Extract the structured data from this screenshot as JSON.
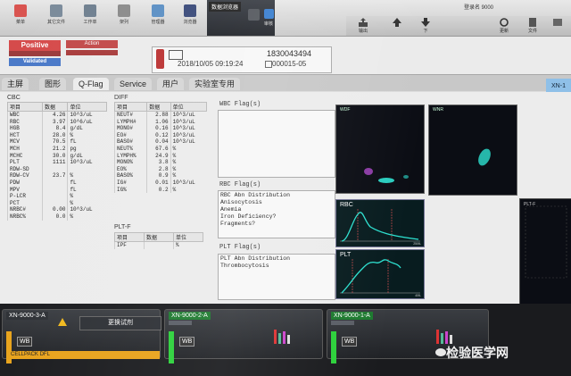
{
  "toolbar": {
    "left_buttons": [
      "菜单",
      "其它文件",
      "工作单",
      "架列",
      "管理器",
      "浏览器"
    ],
    "window_title": "数据浏览器",
    "dark_buttons": [
      "",
      "审核"
    ],
    "right_buttons": [
      "输出",
      "",
      "下",
      "更新",
      "文件",
      ""
    ],
    "login": "登录名 9000"
  },
  "status": {
    "positive": "Positive",
    "positive_tag": "",
    "validated": "Validated",
    "action": "Action",
    "action_tag": ""
  },
  "sample": {
    "number": "1830043494",
    "datetime": "2018/10/05 09:19:24",
    "rack": "000015-05"
  },
  "tabs": [
    "主屏",
    "图形",
    "Q-Flag",
    "Service",
    "用户",
    "实验室专用"
  ],
  "tab_xn": "XN-1",
  "cbc": {
    "title": "CBC",
    "headers": [
      "项目",
      "数据",
      "单位"
    ],
    "rows": [
      [
        "WBC",
        "4.26",
        "10^3/uL"
      ],
      [
        "RBC",
        "3.97",
        "10^6/uL"
      ],
      [
        "HGB",
        "8.4",
        "g/dL"
      ],
      [
        "HCT",
        "28.0",
        "%"
      ],
      [
        "MCV",
        "70.5",
        "fL"
      ],
      [
        "MCH",
        "21.2",
        "pg"
      ],
      [
        "MCHC",
        "30.0",
        "g/dL"
      ],
      [
        "PLT",
        "1111",
        "10^3/uL"
      ],
      [
        "RDW-SD",
        "",
        ""
      ],
      [
        "RDW-CV",
        "23.7",
        "%"
      ],
      [
        "PDW",
        "",
        "fL"
      ],
      [
        "MPV",
        "",
        "fL"
      ],
      [
        "P-LCR",
        "",
        "%"
      ],
      [
        "PCT",
        "",
        "%"
      ],
      [
        "NRBC#",
        "0.00",
        "10^3/uL"
      ],
      [
        "NRBC%",
        "0.0",
        "%"
      ]
    ]
  },
  "diff": {
    "title": "DIFF",
    "headers": [
      "项目",
      "数据",
      "单位"
    ],
    "rows": [
      [
        "NEUT#",
        "2.88",
        "10^3/uL"
      ],
      [
        "LYMPH#",
        "1.06",
        "10^3/uL"
      ],
      [
        "MONO#",
        "0.16",
        "10^3/uL"
      ],
      [
        "EO#",
        "0.12",
        "10^3/uL"
      ],
      [
        "BASO#",
        "0.04",
        "10^3/uL"
      ],
      [
        "NEUT%",
        "67.6",
        "%"
      ],
      [
        "LYMPH%",
        "24.9",
        "%"
      ],
      [
        "MONO%",
        "3.8",
        "%"
      ],
      [
        "EO%",
        "2.8",
        "%"
      ],
      [
        "BASO%",
        "0.9",
        "%"
      ],
      [
        "IG#",
        "0.01",
        "10^3/uL"
      ],
      [
        "IG%",
        "0.2",
        "%"
      ]
    ]
  },
  "pltf": {
    "title": "PLT-F",
    "headers": [
      "项目",
      "数据",
      "单位"
    ],
    "rows": [
      [
        "IPF",
        "",
        "%"
      ]
    ]
  },
  "flags": {
    "wbc_title": "WBC Flag(s)",
    "wbc_items": [],
    "rbc_title": "RBC Flag(s)",
    "rbc_items": [
      "RBC Abn Distribution",
      "Anisocytosis",
      "Anemia",
      "Iron Deficiency?",
      "Fragments?"
    ],
    "plt_title": "PLT Flag(s)",
    "plt_items": [
      "PLT Abn Distribution",
      "Thrombocytosis"
    ]
  },
  "graphs": {
    "wdf": "WDF",
    "wnr": "WNR",
    "rbc": "RBC",
    "plt": "PLT",
    "pltf": "PLT-F",
    "rbc_axis": "250fL",
    "plt_axis": "40fL"
  },
  "bottom": {
    "units": [
      {
        "name": "XN-9000-3-A",
        "mode": "WB",
        "button": "更换试剂"
      },
      {
        "name": "XN-9000-2-A",
        "mode": "WB"
      },
      {
        "name": "XN-9000-1-A",
        "mode": "WB"
      }
    ],
    "reagent_bar": "CELLPACK DFL"
  },
  "watermark": "检验医学网"
}
